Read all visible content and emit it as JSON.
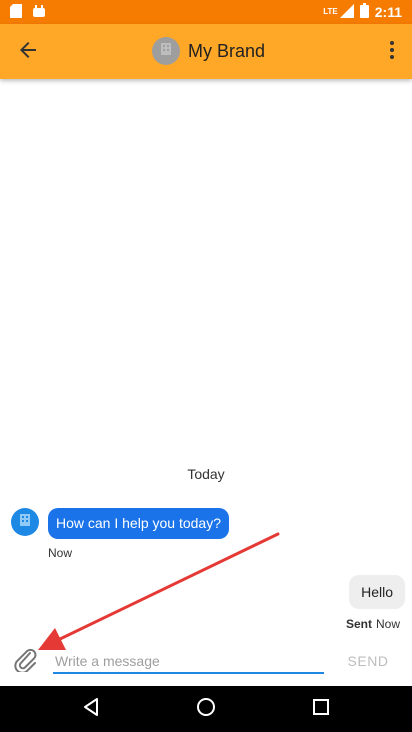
{
  "status_bar": {
    "time": "2:11",
    "network_label": "LTE",
    "icons": [
      "sd-card-icon",
      "android-debug-icon",
      "signal-icon",
      "battery-icon"
    ]
  },
  "app_bar": {
    "title": "My Brand",
    "back_icon": "arrow-back-icon",
    "menu_icon": "more-vert-icon",
    "background": "#ffa726"
  },
  "chat": {
    "date_divider": "Today",
    "messages": [
      {
        "sender": "bot",
        "text": "How can I help you today?",
        "time": "Now"
      },
      {
        "sender": "user",
        "text": "Hello",
        "status": "Sent",
        "time": "Now"
      }
    ]
  },
  "composer": {
    "placeholder": "Write a message",
    "value": "",
    "send_label": "SEND",
    "attach_icon": "paperclip-icon"
  },
  "nav_bar": {
    "icons": [
      "nav-back-icon",
      "nav-home-icon",
      "nav-recents-icon"
    ]
  },
  "colors": {
    "status_bar": "#f57c00",
    "app_bar": "#ffa726",
    "bot_bubble": "#1a73e8",
    "user_bubble": "#eeeeee",
    "input_underline": "#1e88e5",
    "annotation_arrow": "#e53935"
  }
}
